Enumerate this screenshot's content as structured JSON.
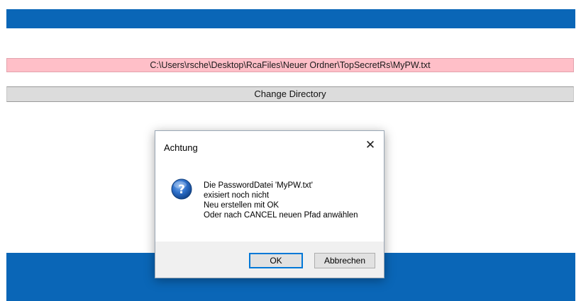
{
  "colors": {
    "accent_bar": "#0a66b7",
    "path_field_bg": "#ffbfc8",
    "button_bg": "#dcdcdc",
    "dialog_footer_bg": "#f0f0f0"
  },
  "main": {
    "path_value": "C:\\Users\\rsche\\Desktop\\RcaFiles\\Neuer Ordner\\TopSecretRs\\MyPW.txt",
    "change_directory_label": "Change Directory"
  },
  "dialog": {
    "title": "Achtung",
    "close_glyph": "✕",
    "icon": "question-icon",
    "message_lines": [
      "Die PasswordDatei 'MyPW.txt'",
      "exisiert noch nicht",
      "Neu erstellen mit OK",
      "Oder nach CANCEL neuen Pfad anwählen"
    ],
    "ok_label": "OK",
    "cancel_label": "Abbrechen"
  }
}
